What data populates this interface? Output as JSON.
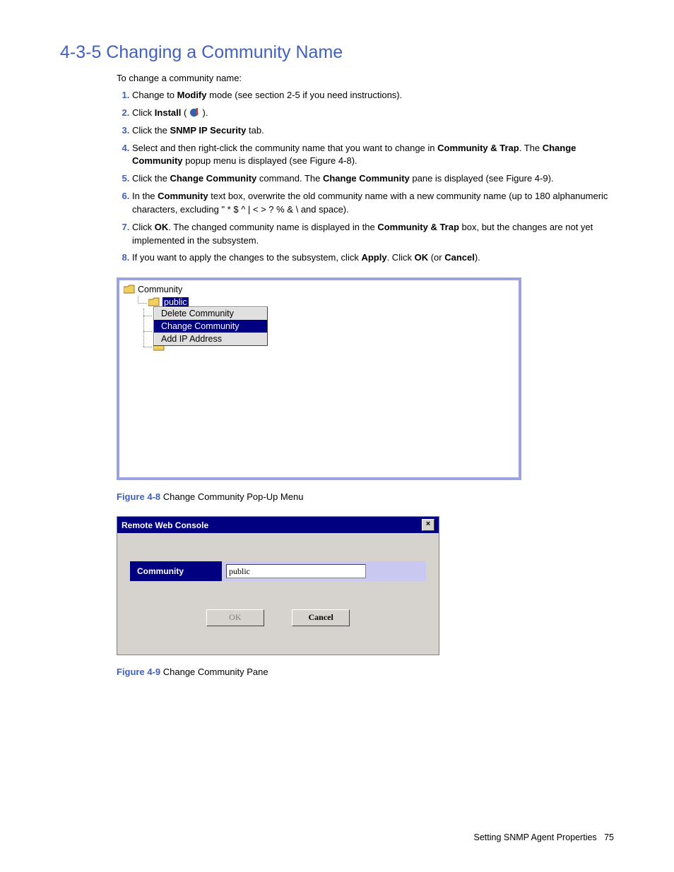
{
  "heading": "4-3-5 Changing a Community Name",
  "intro": "To change a community name:",
  "steps": {
    "s1a": "Change to ",
    "s1b": "Modify",
    "s1c": " mode (see section 2-5 if you need instructions).",
    "s2a": "Click ",
    "s2b": "Install",
    "s2c": " ( ",
    "s2d": " ).",
    "s3a": "Click the ",
    "s3b": "SNMP IP Security",
    "s3c": " tab.",
    "s4a": "Select and then right-click the community name that you want to change in ",
    "s4b": "Community & Trap",
    "s4c": ". The ",
    "s4d": "Change Community",
    "s4e": " popup menu is displayed (see Figure 4-8).",
    "s5a": "Click the ",
    "s5b": "Change Community",
    "s5c": " command. The ",
    "s5d": "Change Community",
    "s5e": " pane is displayed (see Figure 4-9).",
    "s6a": "In the ",
    "s6b": "Community",
    "s6c": " text box, overwrite the old community name with a new community name (up to 180 alphanumeric characters, excluding \"   *   $   ^   |   <   >   ?   %   &   \\   and space).",
    "s7a": "Click ",
    "s7b": "OK",
    "s7c": ". The changed community name is displayed in the ",
    "s7d": "Community & Trap",
    "s7e": " box, but the changes are not yet implemented in the subsystem.",
    "s8a": "If you want to apply the changes to the subsystem, click ",
    "s8b": "Apply",
    "s8c": ". Click ",
    "s8d": "OK",
    "s8e": " (or ",
    "s8f": "Cancel",
    "s8g": ")."
  },
  "fig8": {
    "root": "Community",
    "selected": "public",
    "menu": {
      "delete": "Delete Community",
      "change": "Change Community",
      "addip": "Add IP Address"
    },
    "caption_label": "Figure 4-8",
    "caption_text": " Change Community Pop-Up Menu"
  },
  "fig9": {
    "title": "Remote Web Console",
    "close": "×",
    "field_label": "Community",
    "field_value": "public",
    "ok": "OK",
    "cancel": "Cancel",
    "caption_label": "Figure 4-9",
    "caption_text": " Change Community Pane"
  },
  "footer": {
    "section": "Setting SNMP Agent Properties",
    "page": "75"
  }
}
